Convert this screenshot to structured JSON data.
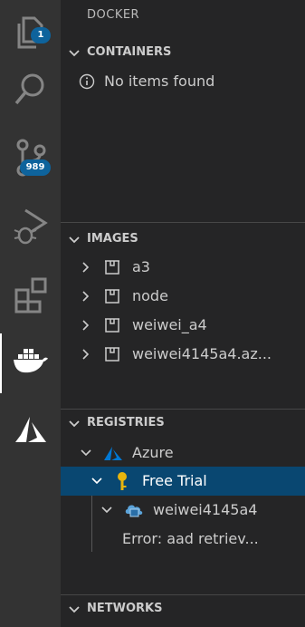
{
  "activity_bar": {
    "explorer_badge": "1",
    "scm_badge": "989",
    "items": [
      "explorer-icon",
      "search-icon",
      "source-control-icon",
      "run-debug-icon",
      "extensions-icon",
      "docker-icon",
      "azure-icon"
    ]
  },
  "sidebar": {
    "title": "DOCKER",
    "containers": {
      "header": "CONTAINERS",
      "empty_message": "No items found"
    },
    "images": {
      "header": "IMAGES",
      "items": [
        {
          "label": "a3"
        },
        {
          "label": "node"
        },
        {
          "label": "weiwei_a4"
        },
        {
          "label": "weiwei4145a4.az..."
        }
      ]
    },
    "registries": {
      "header": "REGISTRIES",
      "azure_label": "Azure",
      "subscription_label": "Free Trial",
      "registry_label": "weiwei4145a4",
      "error_label": "Error: aad retriev..."
    },
    "networks": {
      "header": "NETWORKS"
    }
  },
  "colors": {
    "accent": "#0e639c",
    "selection": "#094771",
    "azure_blue": "#0078d4",
    "key_yellow": "#e8b50d"
  }
}
